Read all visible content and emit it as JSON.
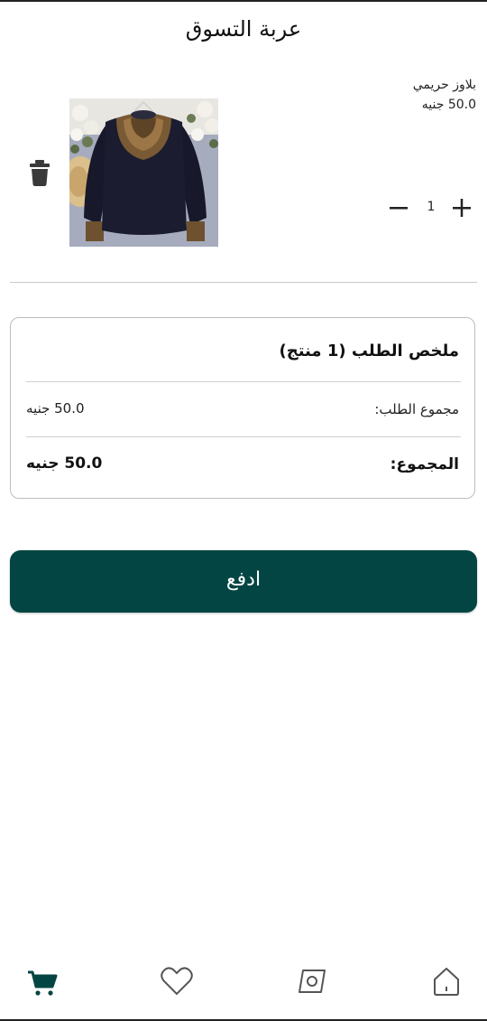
{
  "header": {
    "title": "عربة التسوق"
  },
  "cart": {
    "items": [
      {
        "name": "بلاوز حريمي",
        "price": "50.0 جنيه",
        "quantity": "1",
        "image_alt": "blouse"
      }
    ]
  },
  "summary": {
    "title": "ملخص الطلب (1 منتج)",
    "subtotal_label": "مجموع الطلب:",
    "subtotal_value": "50.0 جنيه",
    "total_label": "المجموع:",
    "total_value": "50.0 جنيه"
  },
  "actions": {
    "pay_label": "ادفع"
  },
  "bottom_nav": {
    "items": [
      {
        "icon": "cart-icon",
        "active": true
      },
      {
        "icon": "heart-icon",
        "active": false
      },
      {
        "icon": "explore-icon",
        "active": false
      },
      {
        "icon": "home-icon",
        "active": false
      }
    ]
  },
  "colors": {
    "primary": "#034542",
    "nav_active": "#034542",
    "nav_inactive": "#555555"
  }
}
